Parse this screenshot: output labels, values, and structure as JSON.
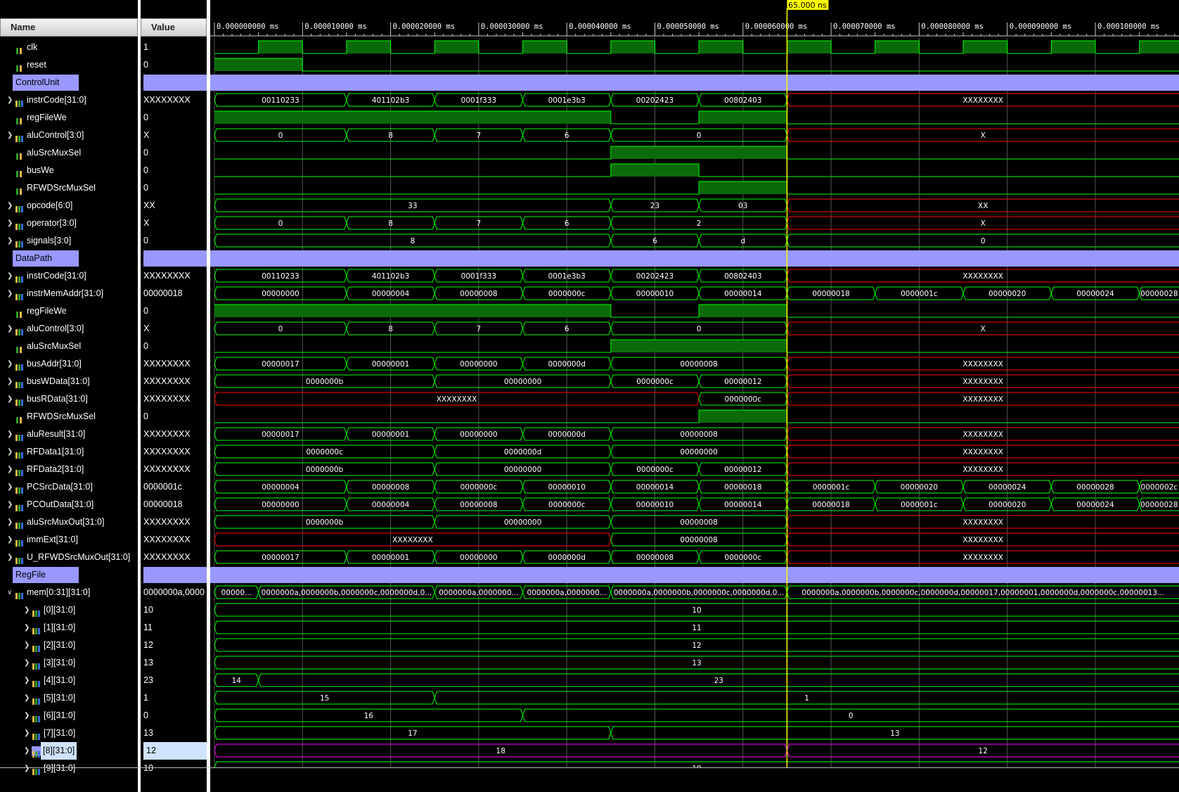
{
  "headers": {
    "name": "Name",
    "value": "Value"
  },
  "cursor": {
    "time_ns": 65,
    "label": "65.000 ns"
  },
  "time_axis": {
    "ticks": [
      "0.000000000 ms",
      "0.000010000 ms",
      "0.000020000 ms",
      "0.000030000 ms",
      "0.000040000 ms",
      "0.000050000 ms",
      "0.000060000 ms",
      "0.000070000 ms",
      "0.000080000 ms",
      "0.000090000 ms",
      "0.000100000 ms"
    ]
  },
  "colors": {
    "wave": "#00ff00",
    "unknown": "#ff0000",
    "selected": "#ff00ff",
    "group": "#9898ff",
    "cursor": "#ffff00",
    "grid": "#555555"
  },
  "signals": [
    {
      "name": "clk",
      "value": "1",
      "kind": "bit",
      "icon": "bit-signal-icon",
      "indent": 1,
      "bits": [
        [
          0,
          0
        ],
        [
          5,
          1
        ],
        [
          10,
          0
        ],
        [
          15,
          1
        ],
        [
          20,
          0
        ],
        [
          25,
          1
        ],
        [
          30,
          0
        ],
        [
          35,
          1
        ],
        [
          40,
          0
        ],
        [
          45,
          1
        ],
        [
          50,
          0
        ],
        [
          55,
          1
        ],
        [
          60,
          0
        ],
        [
          65,
          1
        ],
        [
          70,
          0
        ],
        [
          75,
          1
        ],
        [
          80,
          0
        ],
        [
          85,
          1
        ],
        [
          90,
          0
        ],
        [
          95,
          1
        ],
        [
          100,
          0
        ],
        [
          105,
          1
        ]
      ]
    },
    {
      "name": "reset",
      "value": "0",
      "kind": "bit",
      "icon": "bit-signal-icon",
      "indent": 1,
      "bits": [
        [
          0,
          1
        ],
        [
          10,
          0
        ]
      ]
    },
    {
      "name": "ControlUnit",
      "kind": "group"
    },
    {
      "name": "instrCode[31:0]",
      "value": "XXXXXXXX",
      "kind": "bus",
      "icon": "bus-signal-icon",
      "expand": true,
      "indent": 1,
      "segs": [
        [
          0,
          "00110233"
        ],
        [
          15,
          "401102b3"
        ],
        [
          25,
          "0001f333"
        ],
        [
          35,
          "0001e3b3"
        ],
        [
          45,
          "00202423"
        ],
        [
          55,
          "00802403"
        ],
        [
          65,
          "XXXXXXXX",
          "x"
        ]
      ]
    },
    {
      "name": "regFileWe",
      "value": "0",
      "kind": "bit",
      "icon": "bit-signal-icon",
      "indent": 1,
      "bits": [
        [
          0,
          1
        ],
        [
          45,
          0
        ],
        [
          55,
          1
        ],
        [
          65,
          0
        ]
      ]
    },
    {
      "name": "aluControl[3:0]",
      "value": "X",
      "kind": "bus",
      "icon": "bus-signal-icon",
      "expand": true,
      "indent": 1,
      "segs": [
        [
          0,
          "0"
        ],
        [
          15,
          "8"
        ],
        [
          25,
          "7"
        ],
        [
          35,
          "6"
        ],
        [
          45,
          "0"
        ],
        [
          65,
          "X",
          "x"
        ]
      ]
    },
    {
      "name": "aluSrcMuxSel",
      "value": "0",
      "kind": "bit",
      "icon": "bit-signal-icon",
      "indent": 1,
      "bits": [
        [
          0,
          0
        ],
        [
          45,
          1
        ],
        [
          65,
          0
        ]
      ]
    },
    {
      "name": "busWe",
      "value": "0",
      "kind": "bit",
      "icon": "bit-signal-icon",
      "indent": 1,
      "bits": [
        [
          0,
          0
        ],
        [
          45,
          1
        ],
        [
          55,
          0
        ]
      ]
    },
    {
      "name": "RFWDSrcMuxSel",
      "value": "0",
      "kind": "bit",
      "icon": "bit-signal-icon",
      "indent": 1,
      "bits": [
        [
          0,
          0
        ],
        [
          55,
          1
        ],
        [
          65,
          0
        ]
      ]
    },
    {
      "name": "opcode[6:0]",
      "value": "XX",
      "kind": "bus",
      "icon": "bus-signal-icon",
      "expand": true,
      "indent": 1,
      "segs": [
        [
          0,
          "33"
        ],
        [
          45,
          "23"
        ],
        [
          55,
          "03"
        ],
        [
          65,
          "XX",
          "x"
        ]
      ]
    },
    {
      "name": "operator[3:0]",
      "value": "X",
      "kind": "bus",
      "icon": "bus-signal-icon",
      "expand": true,
      "indent": 1,
      "segs": [
        [
          0,
          "0"
        ],
        [
          15,
          "8"
        ],
        [
          25,
          "7"
        ],
        [
          35,
          "6"
        ],
        [
          45,
          "2"
        ],
        [
          65,
          "X",
          "x"
        ]
      ]
    },
    {
      "name": "signals[3:0]",
      "value": "0",
      "kind": "bus",
      "icon": "bus-signal-icon",
      "expand": true,
      "indent": 1,
      "segs": [
        [
          0,
          "8"
        ],
        [
          45,
          "6"
        ],
        [
          55,
          "d"
        ],
        [
          65,
          "0"
        ]
      ]
    },
    {
      "name": "DataPath",
      "kind": "group"
    },
    {
      "name": "instrCode[31:0]",
      "value": "XXXXXXXX",
      "kind": "bus",
      "icon": "bus-signal-icon",
      "expand": true,
      "indent": 1,
      "segs": [
        [
          0,
          "00110233"
        ],
        [
          15,
          "401102b3"
        ],
        [
          25,
          "0001f333"
        ],
        [
          35,
          "0001e3b3"
        ],
        [
          45,
          "00202423"
        ],
        [
          55,
          "00802403"
        ],
        [
          65,
          "XXXXXXXX",
          "x"
        ]
      ]
    },
    {
      "name": "instrMemAddr[31:0]",
      "value": "00000018",
      "kind": "bus",
      "icon": "bus-signal-icon",
      "expand": true,
      "indent": 1,
      "segs": [
        [
          0,
          "00000000"
        ],
        [
          15,
          "00000004"
        ],
        [
          25,
          "00000008"
        ],
        [
          35,
          "0000000c"
        ],
        [
          45,
          "00000010"
        ],
        [
          55,
          "00000014"
        ],
        [
          65,
          "00000018"
        ],
        [
          75,
          "0000001c"
        ],
        [
          85,
          "00000020"
        ],
        [
          95,
          "00000024"
        ],
        [
          105,
          "00000028"
        ]
      ]
    },
    {
      "name": "regFileWe",
      "value": "0",
      "kind": "bit",
      "icon": "bit-signal-icon",
      "indent": 1,
      "bits": [
        [
          0,
          1
        ],
        [
          45,
          0
        ],
        [
          55,
          1
        ],
        [
          65,
          0
        ]
      ]
    },
    {
      "name": "aluControl[3:0]",
      "value": "X",
      "kind": "bus",
      "icon": "bus-signal-icon",
      "expand": true,
      "indent": 1,
      "segs": [
        [
          0,
          "0"
        ],
        [
          15,
          "8"
        ],
        [
          25,
          "7"
        ],
        [
          35,
          "6"
        ],
        [
          45,
          "0"
        ],
        [
          65,
          "X",
          "x"
        ]
      ]
    },
    {
      "name": "aluSrcMuxSel",
      "value": "0",
      "kind": "bit",
      "icon": "bit-signal-icon",
      "indent": 1,
      "bits": [
        [
          0,
          0
        ],
        [
          45,
          1
        ],
        [
          65,
          0
        ]
      ]
    },
    {
      "name": "busAddr[31:0]",
      "value": "XXXXXXXX",
      "kind": "bus",
      "icon": "bus-signal-icon",
      "expand": true,
      "indent": 1,
      "segs": [
        [
          0,
          "00000017"
        ],
        [
          15,
          "00000001"
        ],
        [
          25,
          "00000000"
        ],
        [
          35,
          "0000000d"
        ],
        [
          45,
          "00000008"
        ],
        [
          65,
          "XXXXXXXX",
          "x"
        ]
      ]
    },
    {
      "name": "busWData[31:0]",
      "value": "XXXXXXXX",
      "kind": "bus",
      "icon": "bus-signal-icon",
      "expand": true,
      "indent": 1,
      "segs": [
        [
          0,
          "0000000b"
        ],
        [
          25,
          "00000000"
        ],
        [
          45,
          "0000000c"
        ],
        [
          55,
          "00000012"
        ],
        [
          65,
          "XXXXXXXX",
          "x"
        ]
      ]
    },
    {
      "name": "busRData[31:0]",
      "value": "XXXXXXXX",
      "kind": "bus",
      "icon": "bus-signal-icon",
      "expand": true,
      "indent": 1,
      "segs": [
        [
          0,
          "XXXXXXXX",
          "x"
        ],
        [
          55,
          "0000000c"
        ],
        [
          65,
          "XXXXXXXX",
          "x"
        ]
      ]
    },
    {
      "name": "RFWDSrcMuxSel",
      "value": "0",
      "kind": "bit",
      "icon": "bit-signal-icon",
      "indent": 1,
      "bits": [
        [
          0,
          0
        ],
        [
          55,
          1
        ],
        [
          65,
          0
        ]
      ]
    },
    {
      "name": "aluResult[31:0]",
      "value": "XXXXXXXX",
      "kind": "bus",
      "icon": "bus-signal-icon",
      "expand": true,
      "indent": 1,
      "segs": [
        [
          0,
          "00000017"
        ],
        [
          15,
          "00000001"
        ],
        [
          25,
          "00000000"
        ],
        [
          35,
          "0000000d"
        ],
        [
          45,
          "00000008"
        ],
        [
          65,
          "XXXXXXXX",
          "x"
        ]
      ]
    },
    {
      "name": "RFData1[31:0]",
      "value": "XXXXXXXX",
      "kind": "bus",
      "icon": "bus-signal-icon",
      "expand": true,
      "indent": 1,
      "segs": [
        [
          0,
          "0000000c"
        ],
        [
          25,
          "0000000d"
        ],
        [
          45,
          "00000000"
        ],
        [
          65,
          "XXXXXXXX",
          "x"
        ]
      ]
    },
    {
      "name": "RFData2[31:0]",
      "value": "XXXXXXXX",
      "kind": "bus",
      "icon": "bus-signal-icon",
      "expand": true,
      "indent": 1,
      "segs": [
        [
          0,
          "0000000b"
        ],
        [
          25,
          "00000000"
        ],
        [
          45,
          "0000000c"
        ],
        [
          55,
          "00000012"
        ],
        [
          65,
          "XXXXXXXX",
          "x"
        ]
      ]
    },
    {
      "name": "PCSrcData[31:0]",
      "value": "0000001c",
      "kind": "bus",
      "icon": "bus-signal-icon",
      "expand": true,
      "indent": 1,
      "segs": [
        [
          0,
          "00000004"
        ],
        [
          15,
          "00000008"
        ],
        [
          25,
          "0000000c"
        ],
        [
          35,
          "00000010"
        ],
        [
          45,
          "00000014"
        ],
        [
          55,
          "00000018"
        ],
        [
          65,
          "0000001c"
        ],
        [
          75,
          "00000020"
        ],
        [
          85,
          "00000024"
        ],
        [
          95,
          "00000028"
        ],
        [
          105,
          "0000002c"
        ]
      ]
    },
    {
      "name": "PCOutData[31:0]",
      "value": "00000018",
      "kind": "bus",
      "icon": "bus-signal-icon",
      "expand": true,
      "indent": 1,
      "segs": [
        [
          0,
          "00000000"
        ],
        [
          15,
          "00000004"
        ],
        [
          25,
          "00000008"
        ],
        [
          35,
          "0000000c"
        ],
        [
          45,
          "00000010"
        ],
        [
          55,
          "00000014"
        ],
        [
          65,
          "00000018"
        ],
        [
          75,
          "0000001c"
        ],
        [
          85,
          "00000020"
        ],
        [
          95,
          "00000024"
        ],
        [
          105,
          "00000028"
        ]
      ]
    },
    {
      "name": "aluSrcMuxOut[31:0]",
      "value": "XXXXXXXX",
      "kind": "bus",
      "icon": "bus-signal-icon",
      "expand": true,
      "indent": 1,
      "segs": [
        [
          0,
          "0000000b"
        ],
        [
          25,
          "00000000"
        ],
        [
          45,
          "00000008"
        ],
        [
          65,
          "XXXXXXXX",
          "x"
        ]
      ]
    },
    {
      "name": "immExt[31:0]",
      "value": "XXXXXXXX",
      "kind": "bus",
      "icon": "bus-signal-icon",
      "expand": true,
      "indent": 1,
      "segs": [
        [
          0,
          "XXXXXXXX",
          "x"
        ],
        [
          45,
          "00000008"
        ],
        [
          65,
          "XXXXXXXX",
          "x"
        ]
      ]
    },
    {
      "name": "U_RFWDSrcMuxOut[31:0]",
      "value": "XXXXXXXX",
      "kind": "bus",
      "icon": "bus-signal-icon",
      "expand": true,
      "indent": 1,
      "segs": [
        [
          0,
          "00000017"
        ],
        [
          15,
          "00000001"
        ],
        [
          25,
          "00000000"
        ],
        [
          35,
          "0000000d"
        ],
        [
          45,
          "00000008"
        ],
        [
          55,
          "0000000c"
        ],
        [
          65,
          "XXXXXXXX",
          "x"
        ]
      ]
    },
    {
      "name": "RegFile",
      "kind": "group"
    },
    {
      "name": "mem[0:31][31:0]",
      "value": "0000000a,0000",
      "kind": "bus",
      "icon": "bus-signal-icon",
      "expand": true,
      "expanded": true,
      "indent": 1,
      "segs": [
        [
          0,
          "00000..."
        ],
        [
          5,
          "0000000a,0000000b,0000000c,0000000d,0..."
        ],
        [
          25,
          "0000000a,0000000..."
        ],
        [
          35,
          "0000000a,0000000..."
        ],
        [
          45,
          "0000000a,0000000b,0000000c,0000000d,0..."
        ],
        [
          65,
          "0000000a,0000000b,0000000c,0000000d,00000017,00000001,0000000d,0000000c,00000013..."
        ]
      ]
    },
    {
      "name": "[0][31:0]",
      "value": "10",
      "kind": "bus",
      "icon": "bus-signal-icon",
      "expand": true,
      "indent": 2,
      "segs": [
        [
          0,
          "10"
        ]
      ]
    },
    {
      "name": "[1][31:0]",
      "value": "11",
      "kind": "bus",
      "icon": "bus-signal-icon",
      "expand": true,
      "indent": 2,
      "segs": [
        [
          0,
          "11"
        ]
      ]
    },
    {
      "name": "[2][31:0]",
      "value": "12",
      "kind": "bus",
      "icon": "bus-signal-icon",
      "expand": true,
      "indent": 2,
      "segs": [
        [
          0,
          "12"
        ]
      ]
    },
    {
      "name": "[3][31:0]",
      "value": "13",
      "kind": "bus",
      "icon": "bus-signal-icon",
      "expand": true,
      "indent": 2,
      "segs": [
        [
          0,
          "13"
        ]
      ]
    },
    {
      "name": "[4][31:0]",
      "value": "23",
      "kind": "bus",
      "icon": "bus-signal-icon",
      "expand": true,
      "indent": 2,
      "segs": [
        [
          0,
          "14"
        ],
        [
          5,
          "23"
        ]
      ]
    },
    {
      "name": "[5][31:0]",
      "value": "1",
      "kind": "bus",
      "icon": "bus-signal-icon",
      "expand": true,
      "indent": 2,
      "segs": [
        [
          0,
          "15"
        ],
        [
          25,
          "1"
        ]
      ]
    },
    {
      "name": "[6][31:0]",
      "value": "0",
      "kind": "bus",
      "icon": "bus-signal-icon",
      "expand": true,
      "indent": 2,
      "segs": [
        [
          0,
          "16"
        ],
        [
          35,
          "0"
        ]
      ]
    },
    {
      "name": "[7][31:0]",
      "value": "13",
      "kind": "bus",
      "icon": "bus-signal-icon",
      "expand": true,
      "indent": 2,
      "segs": [
        [
          0,
          "17"
        ],
        [
          45,
          "13"
        ]
      ]
    },
    {
      "name": "[8][31:0]",
      "value": "12",
      "kind": "bus",
      "icon": "bus-signal-icon",
      "expand": true,
      "indent": 2,
      "selected": true,
      "segs": [
        [
          0,
          "18"
        ],
        [
          65,
          "12"
        ]
      ]
    },
    {
      "name": "[9][31:0]",
      "value": "10",
      "kind": "bus",
      "icon": "bus-signal-icon",
      "expand": true,
      "indent": 2,
      "partial": true,
      "segs": [
        [
          0,
          "10"
        ]
      ]
    }
  ]
}
